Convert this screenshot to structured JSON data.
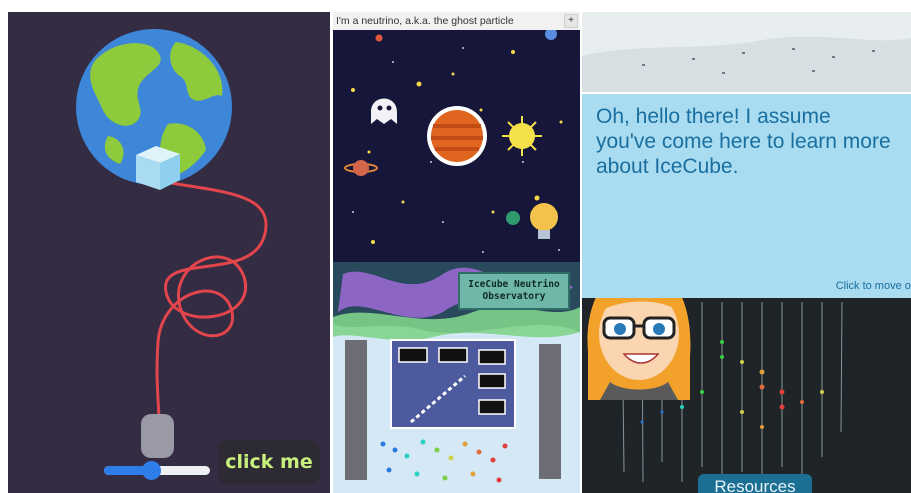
{
  "panels": {
    "earth_game": {
      "click_button_label": "click me",
      "slider_value_fraction": 0.45,
      "accent_colors": {
        "button_text": "#c8f07c",
        "slider": "#2f7de8",
        "cable": "#e2454b"
      }
    },
    "ghost_particle": {
      "title": "I'm a neutrino, a.k.a. the ghost particle",
      "plus_label": "+",
      "sign_text": "IceCube Neutrino Observatory"
    },
    "icecube_guide": {
      "dialog_text": "Oh, hello there! I assume you've come here to learn more about IceCube.",
      "move_on_text": "Click to move on",
      "resources_label": "Resources",
      "accent_colors": {
        "dialog_bg": "#a9dcf0",
        "dialog_text": "#1a6fa0",
        "resources_bg": "#1a6f92"
      }
    }
  }
}
